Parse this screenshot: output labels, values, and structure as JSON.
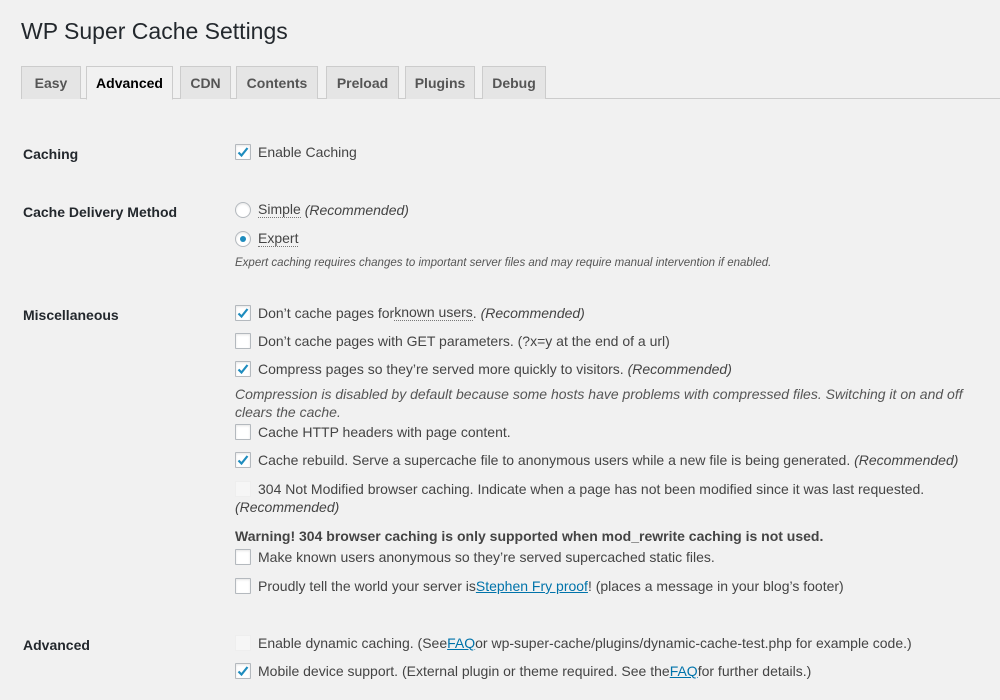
{
  "page": {
    "title": "WP Super Cache Settings"
  },
  "tabs": [
    {
      "label": "Easy",
      "active": false
    },
    {
      "label": "Advanced",
      "active": true
    },
    {
      "label": "CDN",
      "active": false
    },
    {
      "label": "Contents",
      "active": false
    },
    {
      "label": "Preload",
      "active": false
    },
    {
      "label": "Plugins",
      "active": false
    },
    {
      "label": "Debug",
      "active": false
    }
  ],
  "caching": {
    "label": "Caching",
    "enable": {
      "label": "Enable Caching",
      "checked": true
    }
  },
  "delivery": {
    "label": "Cache Delivery Method",
    "simple": {
      "label": "Simple",
      "note": "(Recommended)",
      "selected": false
    },
    "expert": {
      "label": "Expert",
      "selected": true
    },
    "description": "Expert caching requires changes to important server files and may require manual intervention if enabled."
  },
  "misc": {
    "label": "Miscellaneous",
    "known_users": {
      "prefix": "Don’t cache pages for ",
      "link": "known users",
      "suffix": ".",
      "note": "(Recommended)",
      "checked": true
    },
    "get_params": {
      "label": "Don’t cache pages with GET parameters. (?x=y at the end of a url)",
      "checked": false
    },
    "compress": {
      "label": "Compress pages so they’re served more quickly to visitors.",
      "note": "(Recommended)",
      "checked": true
    },
    "compress_desc_line1": "Compression is disabled by default because some hosts have problems with compressed files. Switching it on and off",
    "compress_desc_line2": "clears the cache.",
    "http_headers": {
      "label": "Cache HTTP headers with page content.",
      "checked": false
    },
    "rebuild": {
      "label": "Cache rebuild. Serve a supercache file to anonymous users while a new file is being generated.",
      "note": "(Recommended)",
      "checked": true
    },
    "not_modified": {
      "label": "304 Not Modified browser caching. Indicate when a page has not been modified since it was last requested.",
      "note": "(Recommended)",
      "checked": false,
      "disabled": true
    },
    "warning": "Warning! 304 browser caching is only supported when mod_rewrite caching is not used.",
    "anonymous": {
      "label": "Make known users anonymous so they’re served supercached static files.",
      "checked": false
    },
    "proud": {
      "prefix": "Proudly tell the world your server is ",
      "link": "Stephen Fry proof",
      "suffix": "! (places a message in your blog’s footer)",
      "checked": false
    }
  },
  "advanced": {
    "label": "Advanced",
    "dynamic": {
      "prefix": "Enable dynamic caching. (See ",
      "link": "FAQ",
      "suffix": " or wp-super-cache/plugins/dynamic-cache-test.php for example code.)",
      "checked": false,
      "disabled": true
    },
    "mobile": {
      "prefix": "Mobile device support. (External plugin or theme required. See the ",
      "link": "FAQ",
      "suffix": " for further details.)",
      "checked": true
    }
  },
  "colors": {
    "accent": "#1e8cbe",
    "link": "#0073aa",
    "background": "#f1f1f1"
  }
}
